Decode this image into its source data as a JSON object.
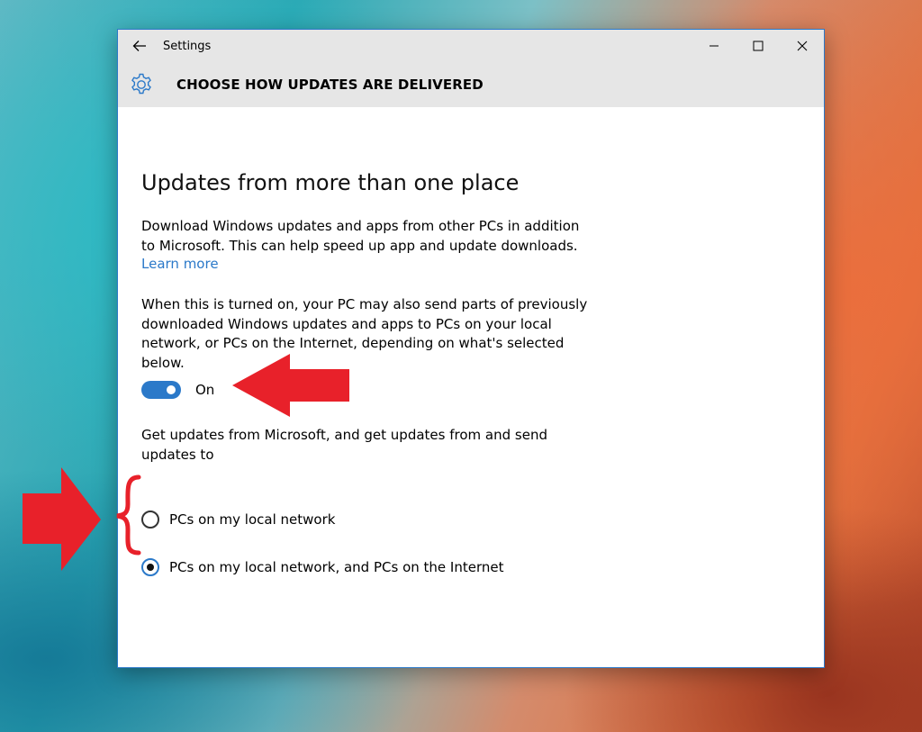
{
  "window": {
    "title": "Settings",
    "back_icon": "arrow-left-icon",
    "controls": [
      "minimize-icon",
      "maximize-icon",
      "close-icon"
    ]
  },
  "header": {
    "icon": "gear-icon",
    "title": "CHOOSE HOW UPDATES ARE DELIVERED",
    "accent_color": "#2b79c9"
  },
  "section": {
    "heading": "Updates from more than one place",
    "description": "Download Windows updates and apps from other PCs in addition to Microsoft. This can help speed up app and update downloads.",
    "learn_more": "Learn more",
    "toggle_info": "When this is turned on, your PC may also send parts of previously downloaded Windows updates and apps to PCs on your local network, or PCs on the Internet, depending on what's selected below.",
    "toggle": {
      "state_label": "On",
      "on": true
    },
    "get_updates_label": "Get updates from Microsoft, and get updates from and send updates to",
    "options": [
      {
        "label": "PCs on my local network",
        "selected": false
      },
      {
        "label": "PCs on my local network, and PCs on the Internet",
        "selected": true
      }
    ]
  },
  "annotations": {
    "color": "#e8212a",
    "items": [
      "arrow-left-annotation",
      "arrow-right-annotation",
      "curly-brace-annotation"
    ]
  }
}
